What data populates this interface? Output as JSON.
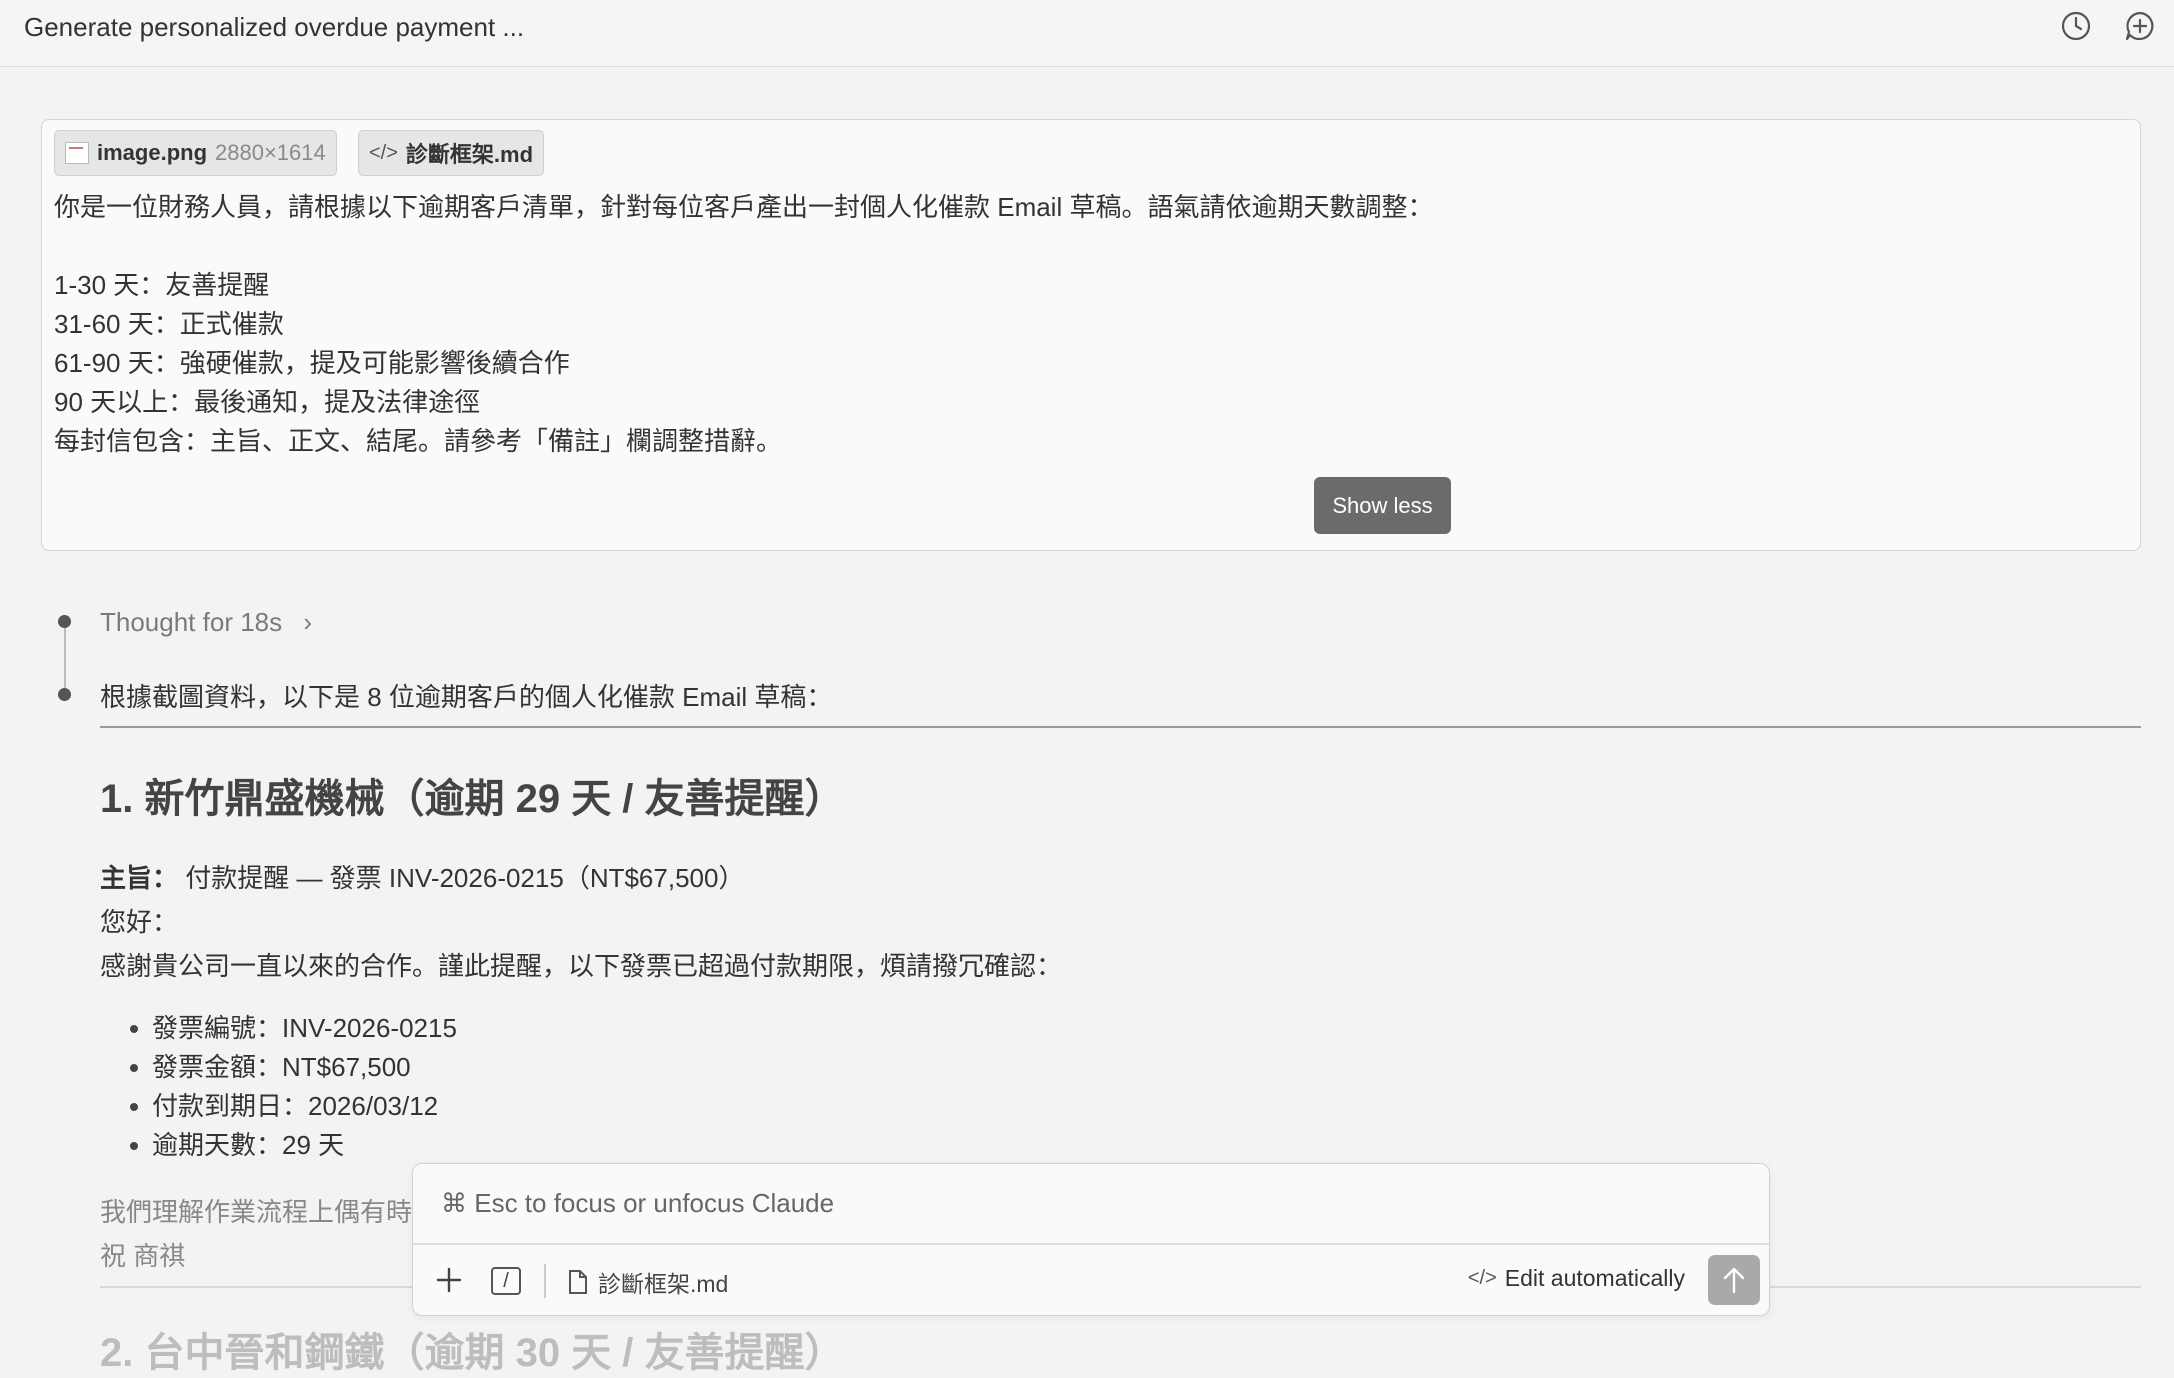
{
  "window": {
    "title": "Generate personalized overdue payment ...",
    "history_icon": "clock-icon",
    "new_chat_icon": "chat-plus-icon"
  },
  "prompt": {
    "attachments": [
      {
        "name": "image.png",
        "meta": "2880×1614",
        "icon": "image-file-icon"
      },
      {
        "name": "診斷框架.md",
        "icon": "code-icon"
      }
    ],
    "lines": [
      "你是一位財務人員，請根據以下逾期客戶清單，針對每位客戶產出一封個人化催款 Email 草稿。語氣請依逾期天數調整：",
      "",
      "1-30 天：友善提醒",
      "31-60 天：正式催款",
      "61-90 天：強硬催款，提及可能影響後續合作",
      "90 天以上：最後通知，提及法律途徑",
      "每封信包含：主旨、正文、結尾。請參考「備註」欄調整措辭。"
    ],
    "show_less_label": "Show less"
  },
  "response": {
    "thought_label": "Thought for 18s",
    "intro": "根據截圖資料，以下是 8 位逾期客戶的個人化催款 Email 草稿：",
    "section1": {
      "heading": "1. 新竹鼎盛機械（逾期 29 天 / 友善提醒）",
      "subject_label": "主旨：",
      "subject_value": " 付款提醒 — 發票 INV-2026-0215（NT$67,500）",
      "greeting": "您好：",
      "body": "感謝貴公司一直以來的合作。謹此提醒，以下發票已超過付款期限，煩請撥冗確認：",
      "bullets": [
        "發票編號：INV-2026-0215",
        "發票金額：NT$67,500",
        "付款到期日：2026/03/12",
        "逾期天數：29 天"
      ],
      "closing_partial": "我們理解作業流程上偶有時",
      "signoff": "祝 商祺"
    },
    "section2_heading_partial": "2. 台中晉和鋼鐵（逾期 30 天 / 友善提醒）"
  },
  "composer": {
    "hint": "⌘ Esc to focus or unfocus Claude",
    "attached_file": "診斷框架.md",
    "edit_mode_label": "Edit automatically",
    "add_icon": "plus-icon",
    "slash_icon": "slash-command-icon",
    "file_icon": "document-icon",
    "send_icon": "arrow-up-icon"
  }
}
